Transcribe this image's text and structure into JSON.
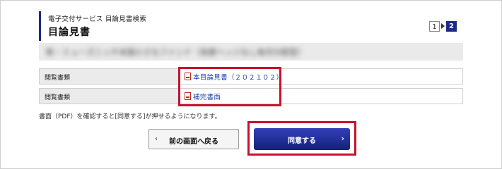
{
  "header": {
    "subtitle": "電子交付サービス 目論見書検索",
    "title": "目論見書"
  },
  "steps": {
    "step1": "1",
    "step2": "2",
    "current": 2
  },
  "fund_name": "新・ミューズニッチ米国小さなファンド（為替ヘッジなし毎月分配型）",
  "rows": [
    {
      "label": "閲覧書類",
      "doc": "本目論見書（２０２１０２）",
      "icon": "pdf-icon"
    },
    {
      "label": "閲覧書類",
      "doc": "補完書面",
      "icon": "pdf-icon"
    }
  ],
  "note": "書面（PDF）を確認すると[同意する]が押せるようになります。",
  "buttons": {
    "back": "前の画面へ戻る",
    "back_chevron": "‹",
    "agree": "同意する",
    "agree_chevron": "›"
  },
  "colors": {
    "brand": "#1d2a8a",
    "highlight": "#c8102e",
    "link": "#1a3fa8"
  }
}
